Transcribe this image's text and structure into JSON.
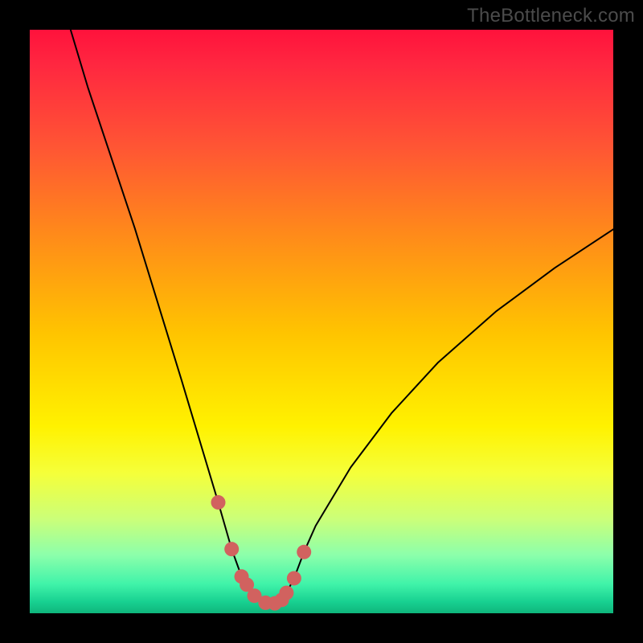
{
  "watermark": "TheBottleneck.com",
  "chart_data": {
    "type": "line",
    "title": "",
    "xlabel": "",
    "ylabel": "",
    "xlim": [
      0,
      100
    ],
    "ylim": [
      0,
      100
    ],
    "series": [
      {
        "name": "bottleneck-curve",
        "x": [
          7.0,
          10.0,
          14.0,
          18.0,
          22.0,
          26.0,
          29.0,
          32.3,
          34.6,
          36.3,
          37.2,
          38.7,
          40.4,
          42.0,
          43.2,
          44.0,
          45.3,
          47.0,
          49.0,
          55.0,
          62.0,
          70.0,
          80.0,
          90.0,
          100.0
        ],
        "y": [
          100.0,
          90.0,
          78.0,
          66.0,
          53.0,
          40.0,
          30.0,
          19.0,
          11.0,
          6.3,
          4.9,
          3.0,
          1.8,
          1.7,
          2.3,
          3.5,
          6.0,
          10.5,
          15.0,
          25.0,
          34.3,
          43.0,
          51.8,
          59.2,
          65.8
        ]
      }
    ],
    "highlight_points": {
      "name": "marked-dots",
      "color": "#d1625f",
      "x": [
        32.3,
        34.6,
        36.3,
        37.2,
        38.5,
        40.4,
        42.0,
        43.2,
        44.0,
        45.3,
        47.0
      ],
      "y": [
        19.0,
        11.0,
        6.3,
        4.9,
        3.0,
        1.8,
        1.7,
        2.3,
        3.5,
        6.0,
        10.5
      ]
    },
    "gradient_stops": [
      {
        "pos": 0.0,
        "color": "#ff123c"
      },
      {
        "pos": 0.06,
        "color": "#ff2740"
      },
      {
        "pos": 0.2,
        "color": "#ff5534"
      },
      {
        "pos": 0.35,
        "color": "#ff8a1a"
      },
      {
        "pos": 0.52,
        "color": "#ffc400"
      },
      {
        "pos": 0.68,
        "color": "#fff200"
      },
      {
        "pos": 0.76,
        "color": "#f5ff3a"
      },
      {
        "pos": 0.84,
        "color": "#caff7a"
      },
      {
        "pos": 0.9,
        "color": "#8cffab"
      },
      {
        "pos": 0.95,
        "color": "#40f3a9"
      },
      {
        "pos": 0.98,
        "color": "#18d191"
      },
      {
        "pos": 1.0,
        "color": "#0fb57c"
      }
    ]
  }
}
